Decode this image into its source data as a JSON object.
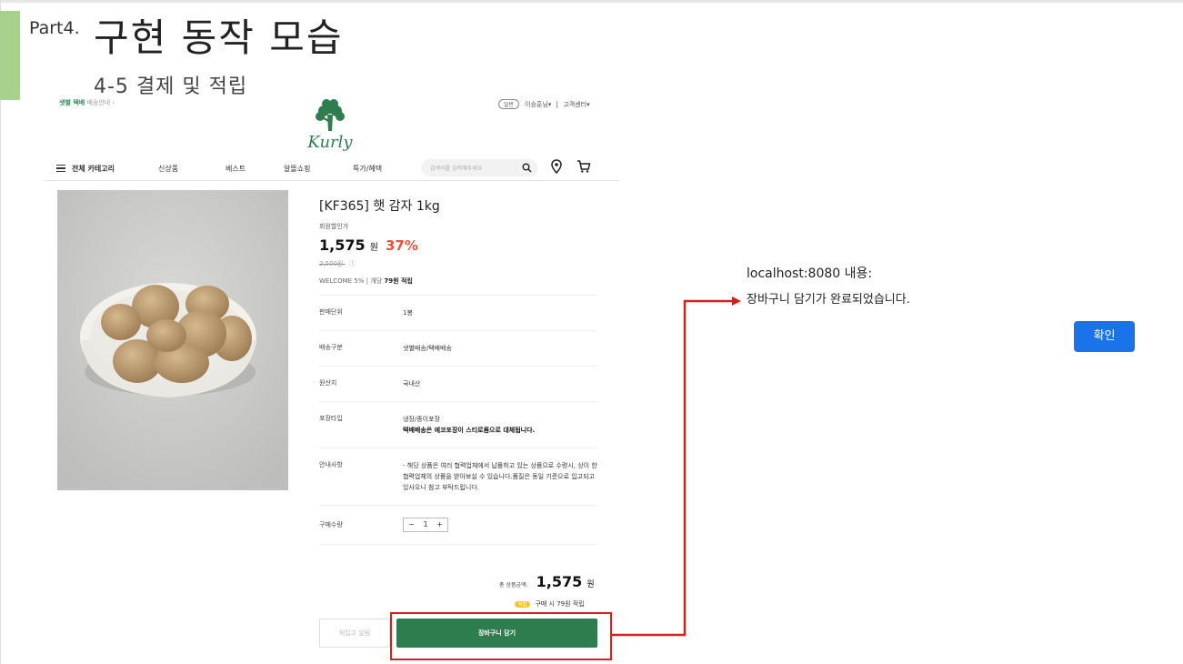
{
  "slide": {
    "part": "Part4.",
    "title": "구현 동작 모습",
    "subtitle": "4-5 결제 및 적립"
  },
  "kurly": {
    "delivery_bold": "샛별 택배",
    "delivery_rest": "배송안내 ›",
    "top_links": [
      "일반",
      "이승훈님▾",
      "고객센터▾"
    ],
    "logo_text": "Kurly",
    "nav": {
      "category": "전체 카테고리",
      "items": [
        "신상품",
        "베스트",
        "알뜰쇼핑",
        "특가/혜택"
      ],
      "search_placeholder": "검색어를 입력해주세요"
    },
    "product": {
      "name": "[KF365] 햇 감자 1kg",
      "member_price_label": "회원할인가",
      "price": "1,575",
      "price_unit": "원",
      "discount": "37%",
      "original_price": "2,500원",
      "welcome": "WELCOME  5%",
      "welcome_earn_prefix": "개당",
      "welcome_earn": "79원 적립",
      "rows": [
        {
          "key": "판매단위",
          "value": "1봉",
          "extra": ""
        },
        {
          "key": "배송구분",
          "value": "샛별배송/택배배송",
          "extra": ""
        },
        {
          "key": "원산지",
          "value": "국내산",
          "extra": ""
        },
        {
          "key": "포장타입",
          "value": "냉장/종이포장",
          "extra": "택배배송은 에코포장이 스티로폼으로 대체됩니다."
        },
        {
          "key": "안내사항",
          "value": "- 해당 상품은 여러 협력업체에서 납품하고 있는 상품으로 수령시, 상이 한 협력업체의 상품을 받아보실 수 있습니다.품질은 동일 기준으로 입고되고 있사오니 참고 부탁드립니다.",
          "extra": ""
        }
      ],
      "qty_label": "구매수량",
      "qty_minus": "−",
      "qty_value": "1",
      "qty_plus": "+",
      "total_label": "총 상품금액:",
      "total_value": "1,575",
      "total_unit": "원",
      "earn_badge": "적립",
      "earn_text": "구매 시 79원 적립",
      "notify_button": "재입고 알림",
      "cart_button": "장바구니 담기"
    }
  },
  "dialog": {
    "title": "localhost:8080 내용:",
    "message": "장바구니 담기가 완료되었습니다.",
    "ok_button": "확인"
  },
  "colors": {
    "accent_bar": "#a9d18e",
    "kurly_green": "#2e7d4f",
    "highlight_red": "#d62020",
    "dialog_blue": "#1a73e8",
    "discount_red": "#e8543a"
  }
}
